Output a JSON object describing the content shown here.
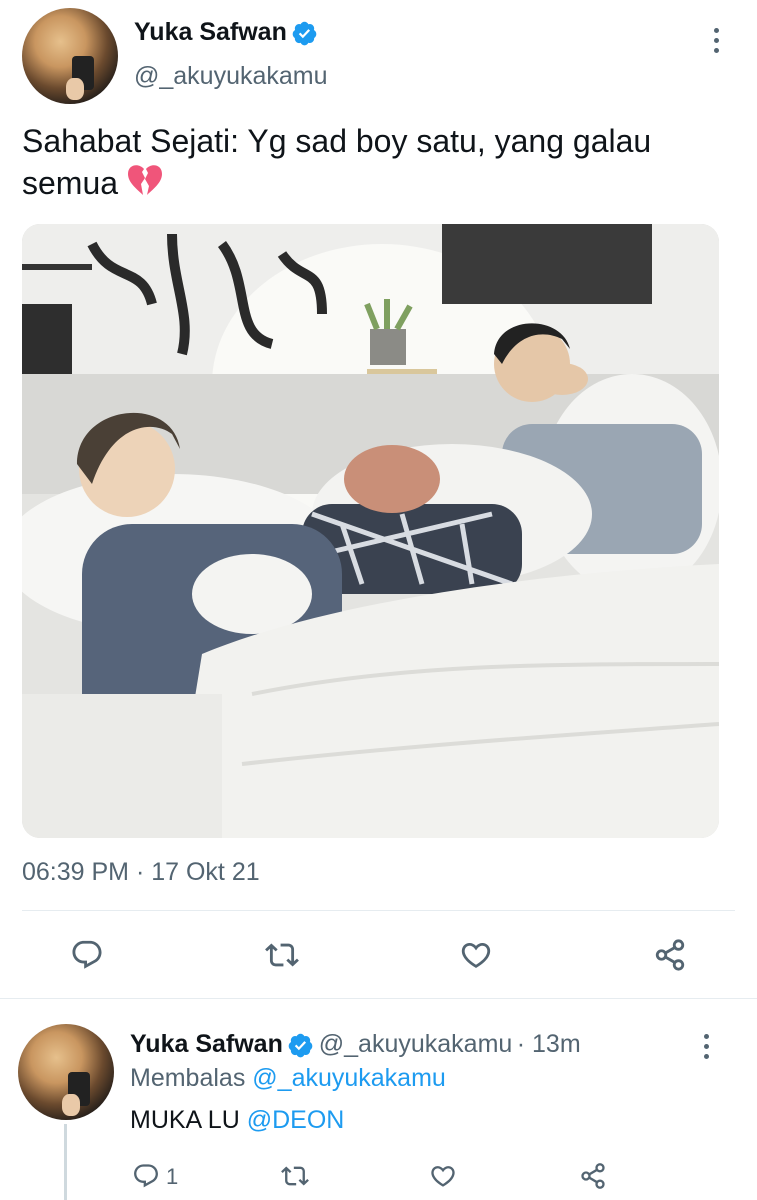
{
  "tweet": {
    "author_name": "Yuka Safwan",
    "author_handle": "@_akuyukakamu",
    "text_line1": "Sahabat Sejati: Yg sad boy satu, yang galau",
    "text_line2": "semua",
    "emoji": "💔",
    "timestamp": "06:39 PM · 17 Okt 21",
    "photo_description": "Three people lying in a bed with white sheets"
  },
  "reply": {
    "author_name": "Yuka Safwan",
    "author_handle": "@_akuyukakamu",
    "time": "· 13m",
    "replying_label": "Membalas",
    "replying_to": "@_akuyukakamu",
    "text": "MUKA LU",
    "mention": "@DEON",
    "reply_count": "1"
  },
  "icons": {
    "verified": "verified-badge-icon",
    "more": "more-vertical-icon",
    "reply": "reply-icon",
    "retweet": "retweet-icon",
    "like": "heart-icon",
    "share": "share-icon"
  },
  "colors": {
    "accent": "#1d9bf0",
    "text": "#0f1419",
    "secondary": "#536471",
    "heart_emoji": "#e0245e"
  }
}
